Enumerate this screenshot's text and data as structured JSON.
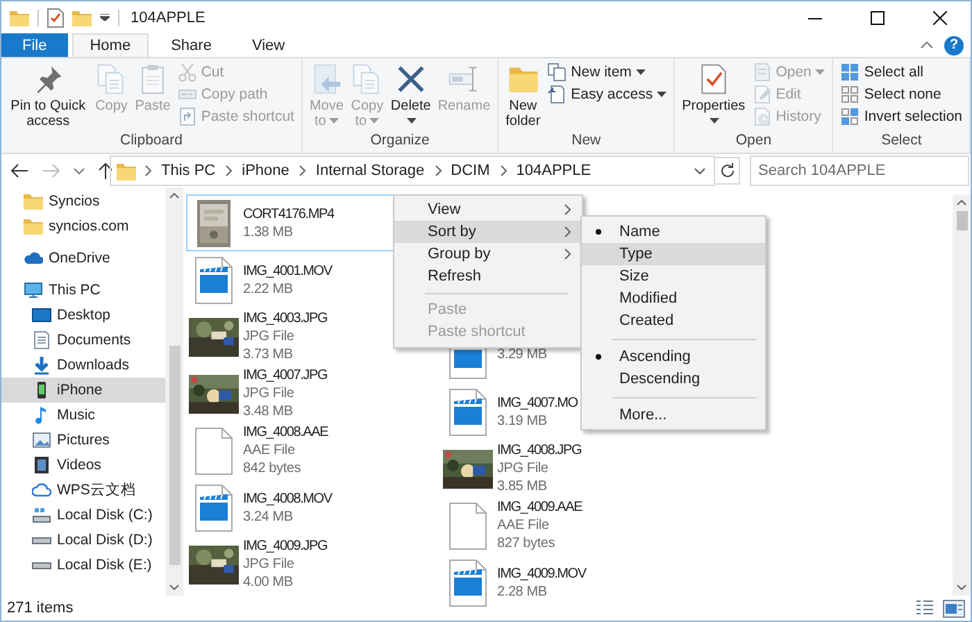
{
  "window": {
    "title": "104APPLE"
  },
  "ribbon_tabs": [
    {
      "label": "File",
      "kind": "file",
      "selected": false
    },
    {
      "label": "Home",
      "kind": "tab",
      "selected": true
    },
    {
      "label": "Share",
      "kind": "tab",
      "selected": false
    },
    {
      "label": "View",
      "kind": "tab",
      "selected": false
    }
  ],
  "help": "?",
  "ribbon": {
    "groups": [
      {
        "label": "Clipboard",
        "buttons": [
          {
            "label": "Pin to Quick access",
            "kind": "large",
            "disabled": false,
            "dropdown": false
          },
          {
            "label": "Copy",
            "kind": "large",
            "disabled": true,
            "dropdown": false
          },
          {
            "label": "Paste",
            "kind": "large",
            "disabled": true,
            "dropdown": false
          },
          {
            "label": "Cut",
            "kind": "small",
            "disabled": true,
            "dropdown": false
          },
          {
            "label": "Copy path",
            "kind": "small",
            "disabled": true,
            "dropdown": false
          },
          {
            "label": "Paste shortcut",
            "kind": "small",
            "disabled": true,
            "dropdown": false
          }
        ]
      },
      {
        "label": "Organize",
        "buttons": [
          {
            "label": "Move to",
            "kind": "large",
            "disabled": true,
            "dropdown": true
          },
          {
            "label": "Copy to",
            "kind": "large",
            "disabled": true,
            "dropdown": true
          },
          {
            "label": "Delete",
            "kind": "large",
            "disabled": false,
            "dropdown": true
          },
          {
            "label": "Rename",
            "kind": "large",
            "disabled": true,
            "dropdown": false
          }
        ]
      },
      {
        "label": "New",
        "buttons": [
          {
            "label": "New folder",
            "kind": "large",
            "disabled": false,
            "dropdown": false
          },
          {
            "label": "New item",
            "kind": "small",
            "disabled": false,
            "dropdown": true
          },
          {
            "label": "Easy access",
            "kind": "small",
            "disabled": false,
            "dropdown": true
          }
        ]
      },
      {
        "label": "Open",
        "buttons": [
          {
            "label": "Properties",
            "kind": "large",
            "disabled": false,
            "dropdown": true
          },
          {
            "label": "Open",
            "kind": "small",
            "disabled": true,
            "dropdown": true
          },
          {
            "label": "Edit",
            "kind": "small",
            "disabled": true,
            "dropdown": false
          },
          {
            "label": "History",
            "kind": "small",
            "disabled": true,
            "dropdown": false
          }
        ]
      },
      {
        "label": "Select",
        "buttons": [
          {
            "label": "Select all",
            "kind": "small",
            "disabled": false,
            "dropdown": false
          },
          {
            "label": "Select none",
            "kind": "small",
            "disabled": false,
            "dropdown": false
          },
          {
            "label": "Invert selection",
            "kind": "small",
            "disabled": false,
            "dropdown": false
          }
        ]
      }
    ]
  },
  "address": {
    "crumbs": [
      "This PC",
      "iPhone",
      "Internal Storage",
      "DCIM",
      "104APPLE"
    ]
  },
  "search": {
    "placeholder": "Search 104APPLE"
  },
  "sidebar": {
    "items": [
      {
        "label": "Syncios",
        "selected": false
      },
      {
        "label": "syncios.com",
        "selected": false
      },
      {
        "label": "OneDrive",
        "selected": false
      },
      {
        "label": "This PC",
        "selected": false,
        "children": [
          {
            "label": "Desktop",
            "selected": false
          },
          {
            "label": "Documents",
            "selected": false
          },
          {
            "label": "Downloads",
            "selected": false
          },
          {
            "label": "iPhone",
            "selected": true
          },
          {
            "label": "Music",
            "selected": false
          },
          {
            "label": "Pictures",
            "selected": false
          },
          {
            "label": "Videos",
            "selected": false
          },
          {
            "label": "WPS云文档",
            "selected": false
          },
          {
            "label": "Local Disk (C:)",
            "selected": false
          },
          {
            "label": "Local Disk (D:)",
            "selected": false
          },
          {
            "label": "Local Disk (E:)",
            "selected": false
          }
        ]
      }
    ]
  },
  "files": {
    "columns": [
      {
        "tiles": [
          {
            "name": "CORT4176.MP4",
            "size": "1.38 MB",
            "kind": "portrait",
            "selected": true
          },
          {
            "name": "IMG_4001.MOV",
            "size": "2.22 MB",
            "kind": "video",
            "selected": false
          },
          {
            "name": "IMG_4003.JPG",
            "type": "JPG File",
            "size": "3.73 MB",
            "selected": false
          },
          {
            "name": "IMG_4007.JPG",
            "type": "JPG File",
            "size": "3.48 MB",
            "selected": false
          },
          {
            "name": "IMG_4008.AAE",
            "type": "AAE File",
            "size": "842 bytes",
            "kind": "document",
            "selected": false
          },
          {
            "name": "IMG_4008.MOV",
            "size": "3.24 MB",
            "kind": "video",
            "selected": false
          },
          {
            "name": "IMG_4009.JPG",
            "type": "JPG File",
            "size": "4.00 MB",
            "selected": false
          }
        ]
      },
      {
        "tiles": [
          {
            "size": "3.29 MB",
            "kind": "video",
            "selected": false
          },
          {
            "name": "IMG_4007.MO",
            "size": "3.19 MB",
            "kind": "video",
            "selected": false
          },
          {
            "name": "IMG_4008.JPG",
            "type": "JPG File",
            "size": "3.85 MB",
            "selected": false
          },
          {
            "name": "IMG_4009.AAE",
            "type": "AAE File",
            "size": "827 bytes",
            "kind": "document",
            "selected": false
          },
          {
            "name": "IMG_4009.MOV",
            "size": "2.28 MB",
            "kind": "video",
            "selected": false
          }
        ]
      }
    ]
  },
  "context_menu": {
    "items": [
      {
        "kind": "item",
        "label": "View",
        "submenu": true,
        "highlighted": false,
        "disabled": false
      },
      {
        "kind": "item",
        "label": "Sort by",
        "submenu": true,
        "highlighted": true,
        "disabled": false
      },
      {
        "kind": "item",
        "label": "Group by",
        "submenu": true,
        "highlighted": false,
        "disabled": false
      },
      {
        "kind": "item",
        "label": "Refresh",
        "submenu": false,
        "highlighted": false,
        "disabled": false
      },
      {
        "kind": "separator"
      },
      {
        "kind": "item",
        "label": "Paste",
        "submenu": false,
        "highlighted": false,
        "disabled": true
      },
      {
        "kind": "item",
        "label": "Paste shortcut",
        "submenu": false,
        "highlighted": false,
        "disabled": true
      }
    ]
  },
  "sort_menu": {
    "items": [
      {
        "kind": "item",
        "label": "Name",
        "checked": true,
        "highlighted": false
      },
      {
        "kind": "item",
        "label": "Type",
        "checked": false,
        "highlighted": true
      },
      {
        "kind": "item",
        "label": "Size",
        "checked": false,
        "highlighted": false
      },
      {
        "kind": "item",
        "label": "Modified",
        "checked": false,
        "highlighted": false
      },
      {
        "kind": "item",
        "label": "Created",
        "checked": false,
        "highlighted": false
      },
      {
        "kind": "separator"
      },
      {
        "kind": "item",
        "label": "Ascending",
        "checked": true,
        "highlighted": false
      },
      {
        "kind": "item",
        "label": "Descending",
        "checked": false,
        "highlighted": false
      },
      {
        "kind": "separator"
      },
      {
        "kind": "item",
        "label": "More...",
        "checked": false,
        "highlighted": false
      }
    ]
  },
  "status_bar": {
    "item_count": "271 items"
  }
}
